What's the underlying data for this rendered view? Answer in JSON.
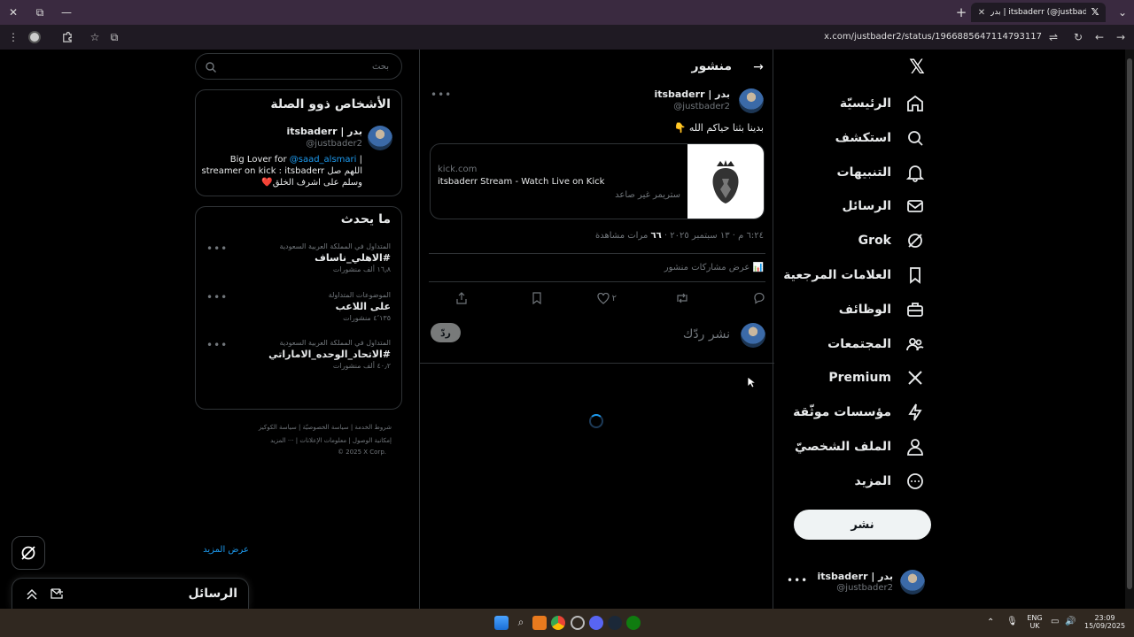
{
  "browser": {
    "tab_title": "بدر | itsbaderr (@justbader2) / X",
    "tab_favicon": "x-logo-icon",
    "url": "x.com/justbader2/status/1966885647114793117"
  },
  "nav": {
    "items": [
      {
        "label": "الرئيسيّة",
        "icon": "home-icon"
      },
      {
        "label": "استكشف",
        "icon": "search-icon"
      },
      {
        "label": "التنبيهات",
        "icon": "bell-icon"
      },
      {
        "label": "الرسائل",
        "icon": "mail-icon"
      },
      {
        "label": "Grok",
        "icon": "grok-icon"
      },
      {
        "label": "العلامات المرجعية",
        "icon": "bookmark-icon"
      },
      {
        "label": "الوظائف",
        "icon": "briefcase-icon"
      },
      {
        "label": "المجتمعات",
        "icon": "communities-icon"
      },
      {
        "label": "Premium",
        "icon": "x-premium-icon"
      },
      {
        "label": "مؤسسات موثّقة",
        "icon": "lightning-icon"
      },
      {
        "label": "الملف الشخصيّ",
        "icon": "person-icon"
      },
      {
        "label": "المزيد",
        "icon": "more-circle-icon"
      }
    ],
    "post_button": "نشر",
    "account": {
      "name": "بدر | itsbaderr",
      "handle": "@justbader2"
    }
  },
  "post": {
    "header_title": "منشور",
    "author_name": "بدر | itsbaderr",
    "author_handle": "@justbader2",
    "text": "بدينا بثنا حياكم الله 👇",
    "card": {
      "domain": "kick.com",
      "title": "itsbaderr Stream - Watch Live on Kick",
      "description": "ستريمر غير صاعد"
    },
    "meta_time": "٦:٢٤ م · ١٣ سبتمبر ٢٠٢٥ ·",
    "meta_views_count": "٦٦",
    "meta_views_label": "مرات مشاهدة",
    "engagements_label": "عرض مشاركات منشور",
    "likes_count": "٢",
    "reply_placeholder": "نشر ردّك",
    "reply_button": "ردّ"
  },
  "sidebar": {
    "search_placeholder": "بحث",
    "related": {
      "title": "الأشخاص ذوو الصلة",
      "name": "بدر | itsbaderr",
      "handle": "@justbader2",
      "bio_line1_prefix": "Big Lover for ",
      "bio_line1_link": "@saad_alsmari",
      "bio_line1_suffix": " |",
      "bio_line2": "streamer on kick : itsbaderr اللهم صل",
      "bio_line3": "وسلم على اشرف الخلق❤️"
    },
    "trends": {
      "title": "ما يحدث",
      "items": [
        {
          "context": "المتداول في المملكة العربية السعودية",
          "name": "#الاهلي_ناساف",
          "count": "١٦٫٨ ألف منشورات"
        },
        {
          "context": "الموضوعات المتداولة",
          "name": "على اللاعب",
          "count": "٤٬١٣٥ منشورات"
        },
        {
          "context": "المتداول في المملكة العربية السعودية",
          "name": "#الاتحاد_الوحده_الاماراتي",
          "count": "٤٠٫٢ ألف منشورات"
        }
      ],
      "show_more": "عرض المزيد"
    },
    "footer": {
      "line1": [
        "شروط الخدمة",
        "سياسة الخصوصيّة",
        "سياسة الكوكيز"
      ],
      "line2": [
        "إمكانية الوصول",
        "معلومات الإعلانات",
        "··· المزيد"
      ],
      "copyright": "© 2025 X Corp."
    }
  },
  "messages_drawer": {
    "title": "الرسائل"
  },
  "taskbar": {
    "lang_top": "ENG",
    "lang_bottom": "UK",
    "time": "23:09",
    "date": "15/09/2025"
  },
  "colors": {
    "accent": "#1d9bf0",
    "border": "#2f3336",
    "muted": "#71767b"
  }
}
